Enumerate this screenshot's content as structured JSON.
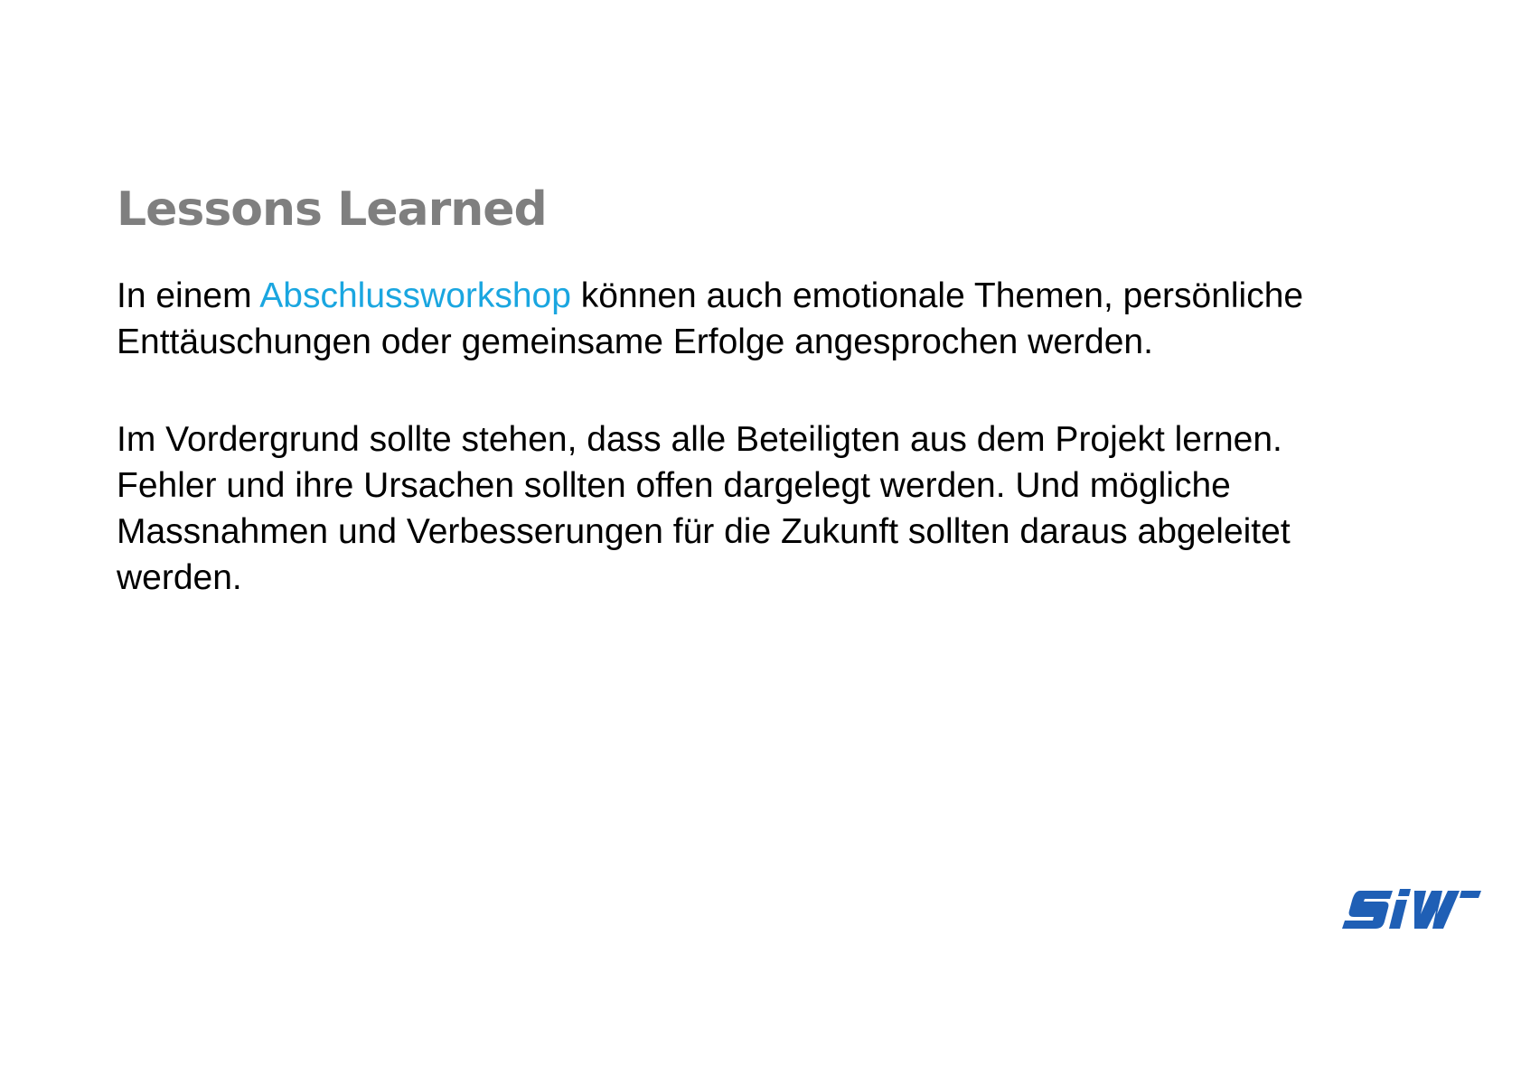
{
  "slide": {
    "title": "Lessons Learned",
    "paragraph1": {
      "before": "In einem ",
      "highlight": "Abschlussworkshop",
      "after": " können auch emotionale Themen, persönliche Enttäuschungen oder gemeinsame Erfolge angesprochen werden."
    },
    "paragraph2": {
      "lines": [
        "Im Vordergrund sollte stehen, dass alle Beteiligten aus dem Projekt lernen.",
        "Fehler und ihre Ursachen sollten offen dargelegt werden. Und mögliche",
        "Massnahmen und Verbesserungen für die Zukunft sollten daraus abgeleitet",
        "werden."
      ]
    },
    "colors": {
      "title": "#7f7f7f",
      "body": "#000000",
      "highlight": "#1aa6e0",
      "logo": "#1f5fb5"
    },
    "logo": {
      "text": "SiW",
      "icon": "siw-logo-icon"
    }
  }
}
